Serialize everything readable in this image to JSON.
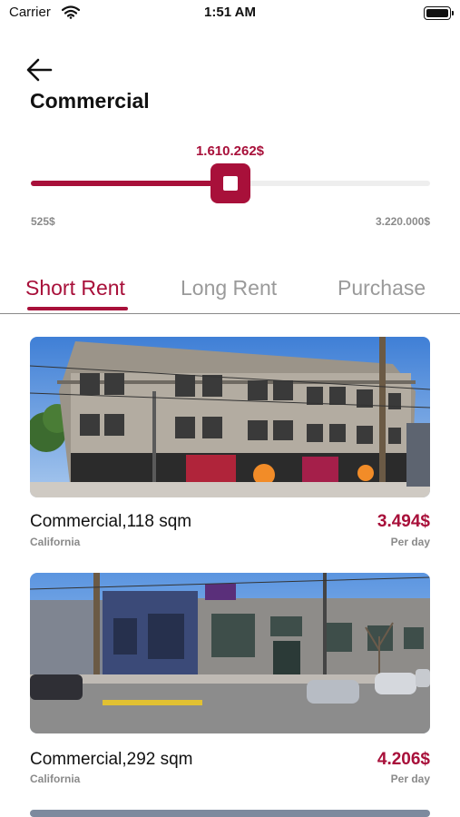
{
  "status_bar": {
    "carrier": "Carrier",
    "time": "1:51 AM"
  },
  "header": {
    "title": "Commercial"
  },
  "price_filter": {
    "current": "1.610.262$",
    "min": "525$",
    "max": "3.220.000$",
    "position_fraction": 0.5
  },
  "tabs": [
    {
      "label": "Short Rent",
      "active": true
    },
    {
      "label": "Long Rent",
      "active": false
    },
    {
      "label": "Purchase",
      "active": false
    }
  ],
  "listings": [
    {
      "name": "Commercial,118 sqm",
      "location": "California",
      "price": "3.494$",
      "unit": "Per day"
    },
    {
      "name": "Commercial,292 sqm",
      "location": "California",
      "price": "4.206$",
      "unit": "Per day"
    }
  ],
  "colors": {
    "accent": "#a8103a",
    "muted": "#8a8a8a",
    "track": "#eeeeee"
  }
}
